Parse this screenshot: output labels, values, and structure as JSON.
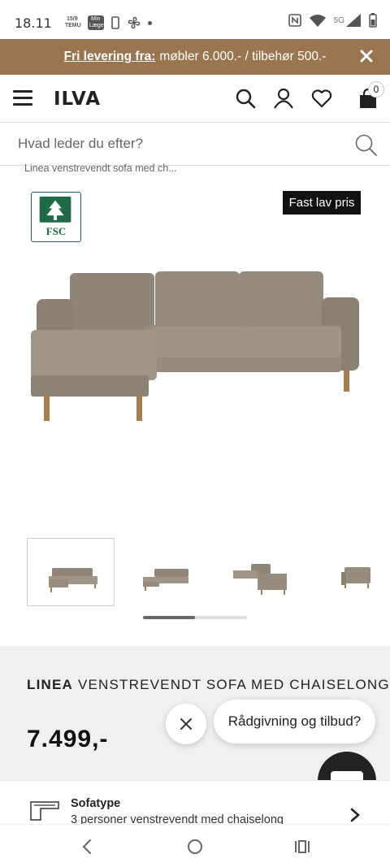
{
  "status_bar": {
    "time": "18.11",
    "notif_icons": [
      "15/9 TEMU",
      "Min Læge"
    ],
    "network": "5G"
  },
  "promo": {
    "lead": "Fri levering fra:",
    "text": "møbler 6.000.- / tilbehør 500.-"
  },
  "header": {
    "logo": "ILVA",
    "cart_count": "0"
  },
  "search": {
    "placeholder": "Hvad leder du efter?"
  },
  "breadcrumb": "Linea venstrevendt sofa med ch...",
  "badges": {
    "fsc": "FSC",
    "price_tag": "Fast lav pris"
  },
  "gallery": {
    "thumbnail_count": 4,
    "active_index": 0
  },
  "product": {
    "brand": "LINEA",
    "name": "VENSTREVENDT SOFA MED CHAISELONG",
    "price": "7.499,-"
  },
  "chat": {
    "bubble": "Rådgivning og tilbud?"
  },
  "option": {
    "title": "Sofatype",
    "value": "3 personer venstrevendt med chaiselong"
  },
  "colors": {
    "promo_bg": "#9a7650",
    "product_bg": "#f2f0ee",
    "fsc_green": "#1f6b46",
    "sofa": "#9b9083"
  }
}
